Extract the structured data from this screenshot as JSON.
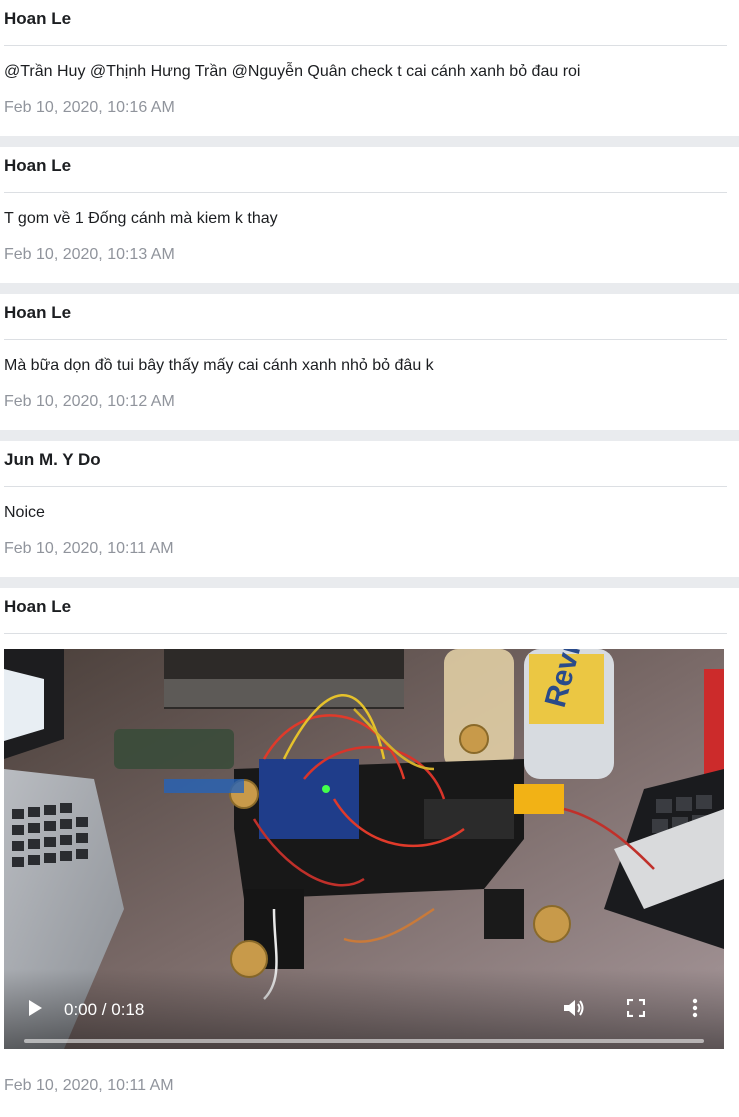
{
  "posts": [
    {
      "author": "Hoan Le",
      "text": "@Trần Huy @Thịnh Hưng Trần @Nguyễn Quân check t cai cánh xanh bỏ đau roi",
      "timestamp": "Feb 10, 2020, 10:16 AM"
    },
    {
      "author": "Hoan Le",
      "text": "T gom về 1 Đống cánh mà kiem k thay",
      "timestamp": "Feb 10, 2020, 10:13 AM"
    },
    {
      "author": "Hoan Le",
      "text": "Mà bữa dọn đồ tui bây thấy mấy cai cánh xanh nhỏ bỏ đâu k",
      "timestamp": "Feb 10, 2020, 10:12 AM"
    },
    {
      "author": "Jun M. Y Do",
      "text": "Noice",
      "timestamp": "Feb 10, 2020, 10:11 AM"
    }
  ],
  "video_post": {
    "author": "Hoan Le",
    "timestamp": "Feb 10, 2020, 10:11 AM",
    "player": {
      "time": "0:00 / 0:18",
      "progress": 0,
      "icons": {
        "play": "play-icon",
        "volume": "volume-icon",
        "fullscreen": "fullscreen-icon",
        "more": "more-vertical-icon"
      }
    }
  },
  "colors": {
    "separator": "#e9ebee",
    "author": "#1c1e21",
    "timestamp": "#90949c"
  }
}
